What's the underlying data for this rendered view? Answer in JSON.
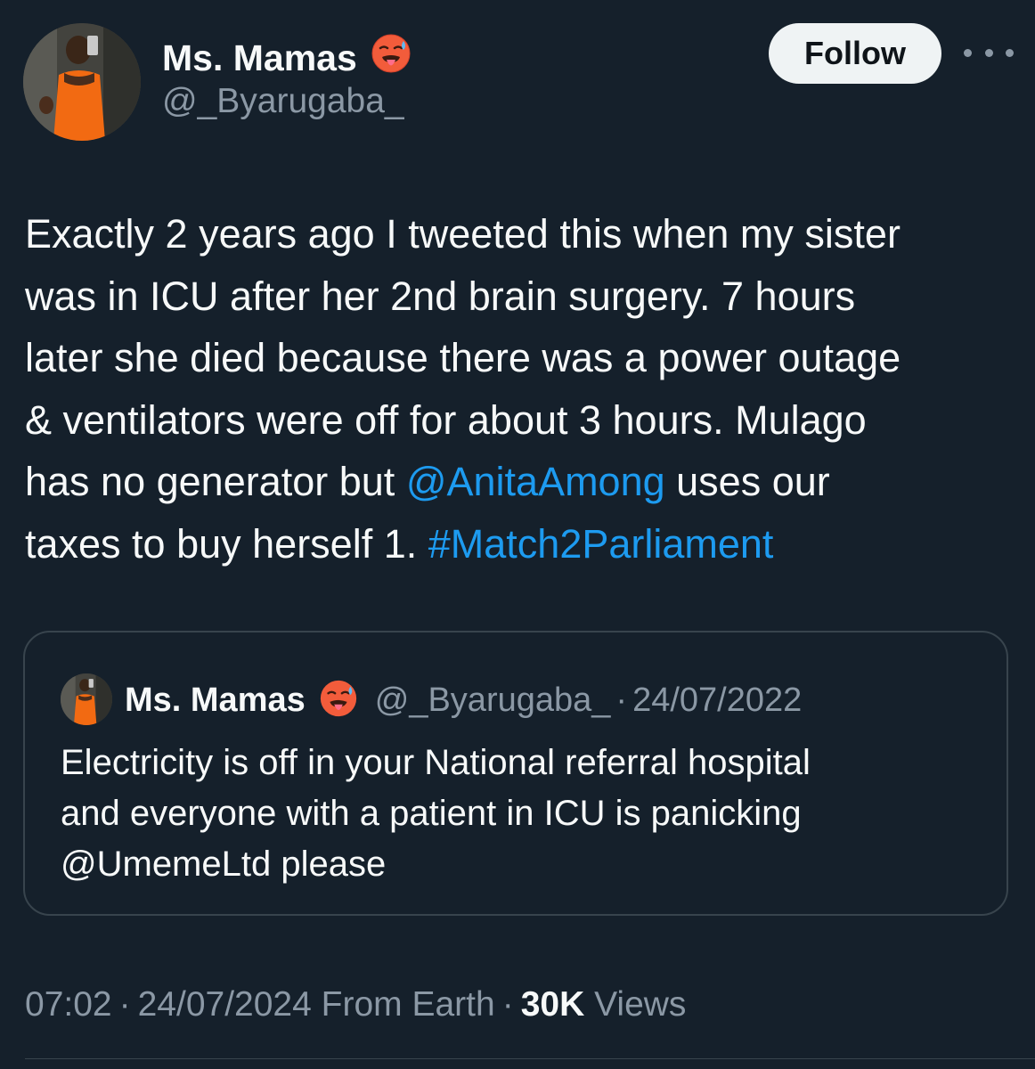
{
  "author": {
    "display_name": "Ms. Mamas",
    "handle": "@_Byarugaba_",
    "emoji_icon": "hot-face-emoji-icon"
  },
  "actions": {
    "follow_label": "Follow",
    "more_icon": "more-icon"
  },
  "tweet": {
    "lines": [
      [
        {
          "t": "Exactly 2 years ago I tweeted this when my sister"
        }
      ],
      [
        {
          "t": "was in ICU after her 2nd brain surgery. 7 hours"
        }
      ],
      [
        {
          "t": "later she died because there was a power outage"
        }
      ],
      [
        {
          "t": "& ventilators were off for about 3 hours. Mulago"
        }
      ],
      [
        {
          "t": "has no  generator but "
        },
        {
          "t": "@AnitaAmong",
          "link": true
        },
        {
          "t": " uses our"
        }
      ],
      [
        {
          "t": "taxes to buy herself 1. "
        },
        {
          "t": "#Match2Parliament",
          "link": true
        }
      ]
    ]
  },
  "quoted_tweet": {
    "display_name": "Ms. Mamas",
    "handle": "@_Byarugaba_",
    "separator": "·",
    "date": "24/07/2022",
    "lines": [
      "Electricity is off in your National referral hospital",
      "and everyone with a patient in ICU is panicking",
      "@UmemeLtd please"
    ]
  },
  "meta": {
    "time": "07:02",
    "separator": "·",
    "date": "24/07/2024",
    "source": "From Earth",
    "views_count": "30K",
    "views_label": "Views"
  },
  "colors": {
    "background": "#15202b",
    "link": "#1d9bf0",
    "secondary_text": "#8b98a5",
    "border": "#38444d"
  }
}
